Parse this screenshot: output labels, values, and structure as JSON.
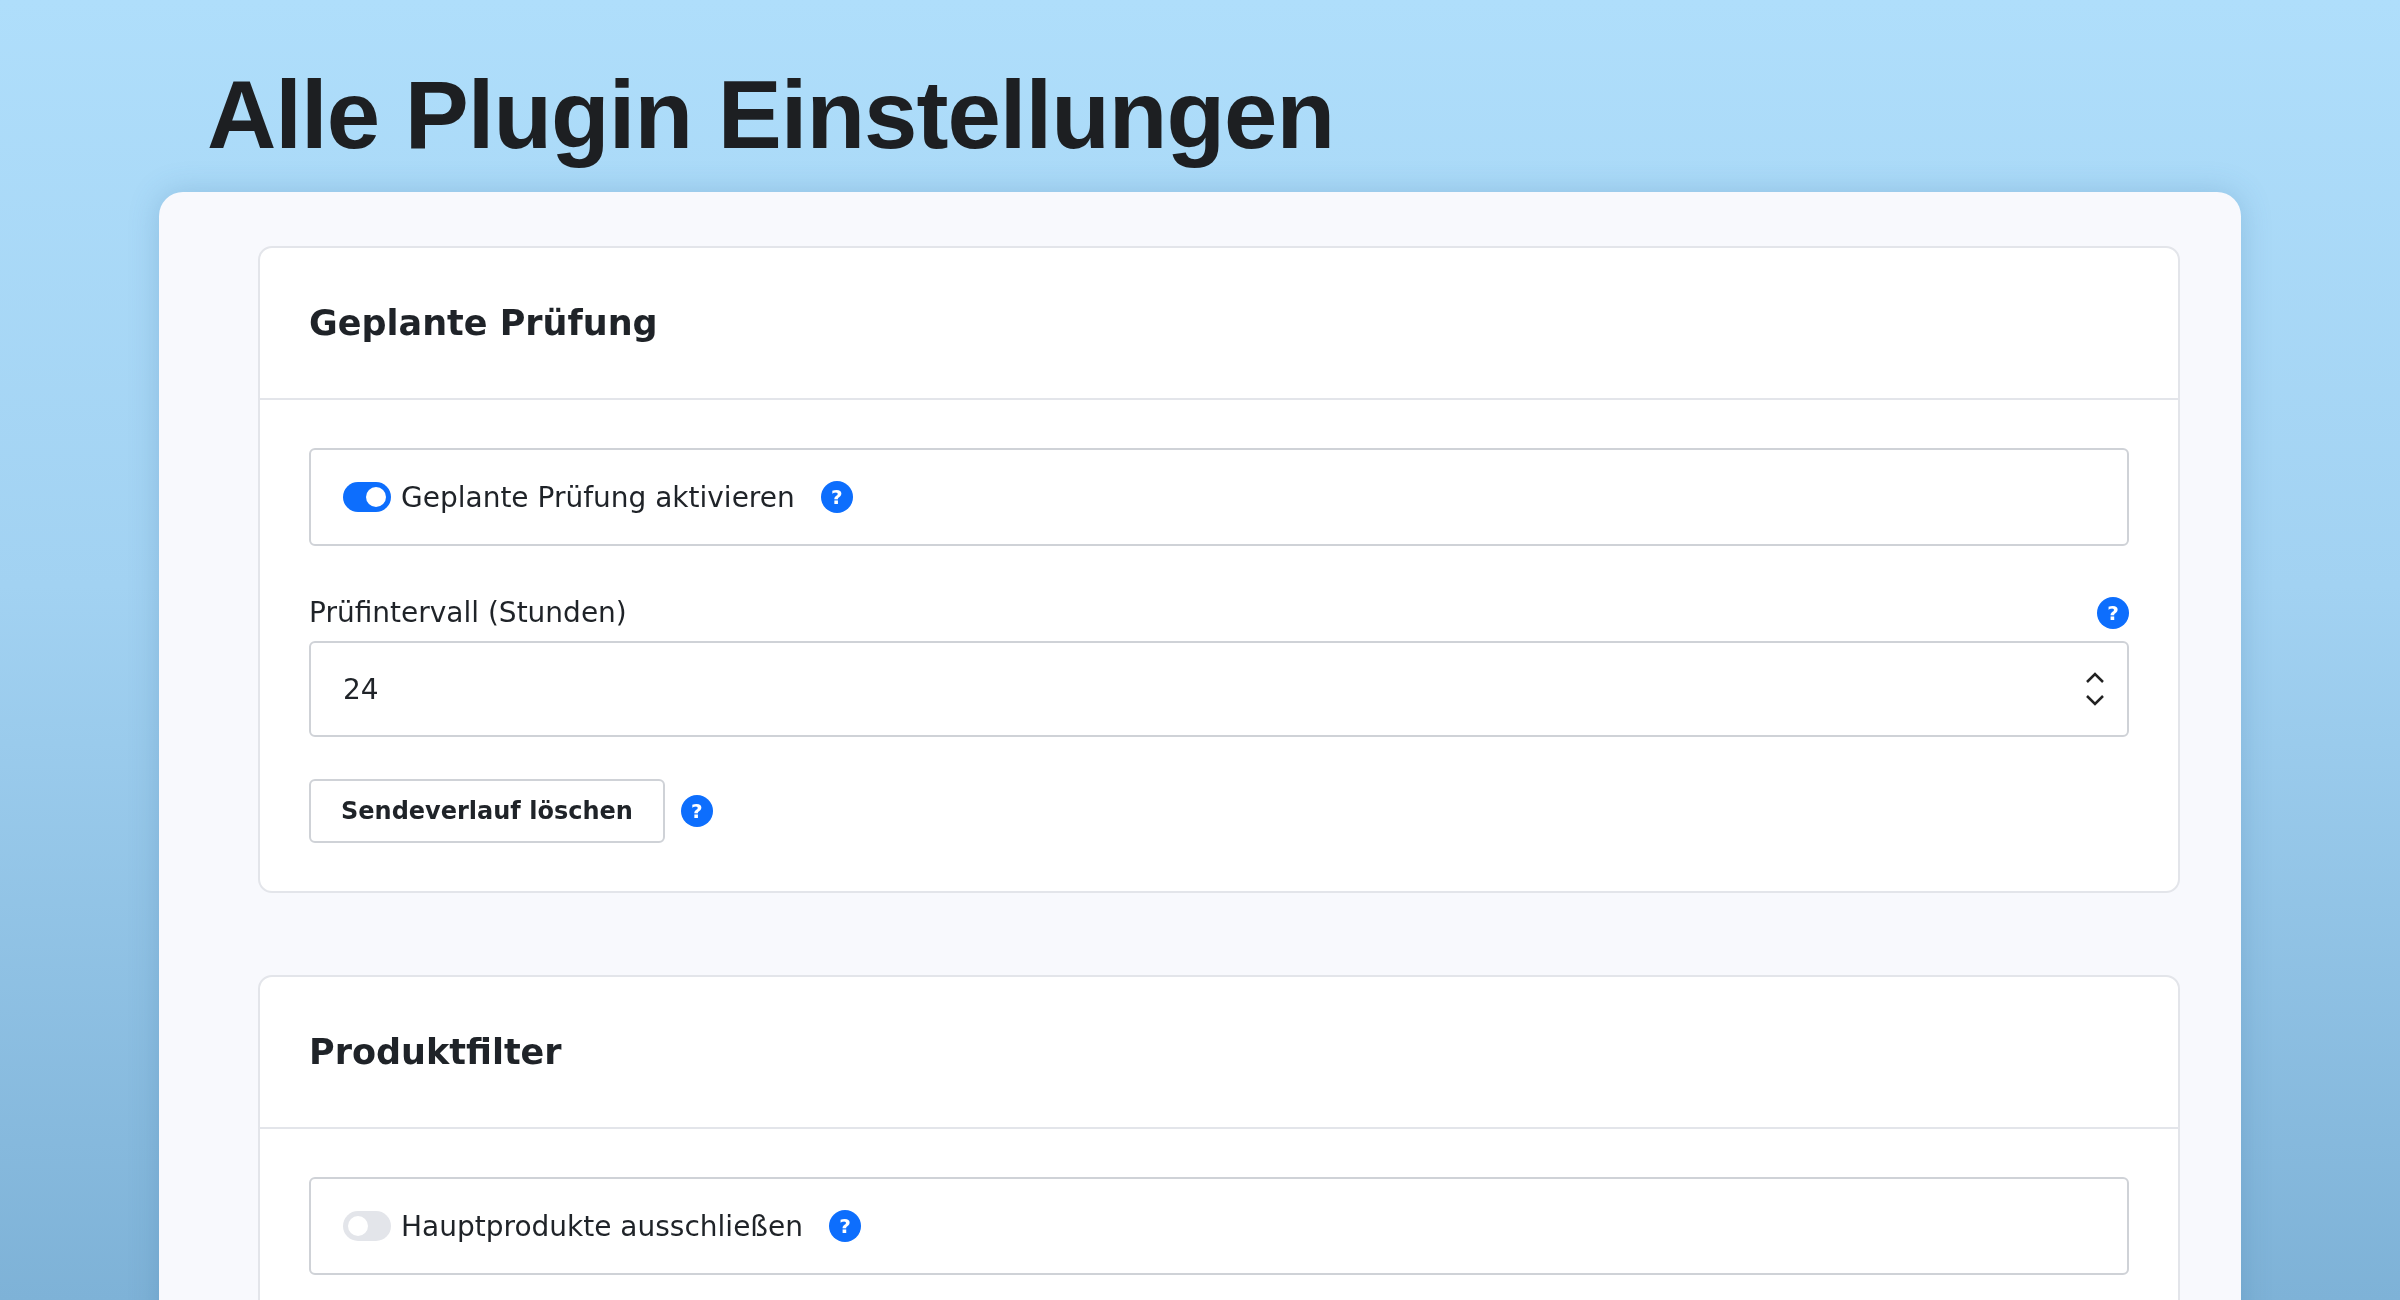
{
  "page_title": "Alle Plugin Einstellungen",
  "sections": [
    {
      "title": "Geplante Prüfung",
      "fields": [
        {
          "kind": "toggle",
          "label": "Geplante Prüfung aktivieren",
          "on": true,
          "help": "?"
        },
        {
          "kind": "number",
          "label": "Prüfintervall (Stunden)",
          "value": "24",
          "help": "?"
        },
        {
          "kind": "button",
          "label": "Sendeverlauf löschen",
          "help": "?"
        }
      ]
    },
    {
      "title": "Produktfilter",
      "fields": [
        {
          "kind": "toggle",
          "label": "Hauptprodukte ausschließen",
          "on": false,
          "help": "?"
        }
      ]
    }
  ]
}
